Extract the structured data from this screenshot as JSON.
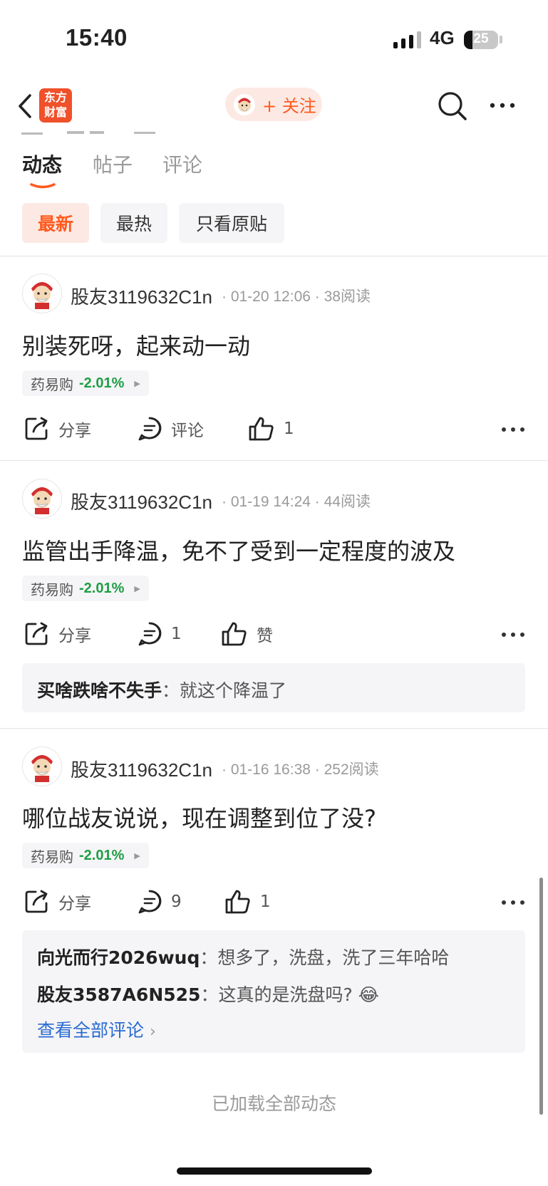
{
  "status_bar": {
    "time": "15:40",
    "network": "4G",
    "battery": "25",
    "battery_level": 0.25
  },
  "nav": {
    "logo_text": "东方财富",
    "logo_line1": "东方",
    "logo_line2": "财富",
    "follow_label": "+ 关注"
  },
  "tabs": [
    {
      "label": "动态",
      "active": true
    },
    {
      "label": "帖子",
      "active": false
    },
    {
      "label": "评论",
      "active": false
    }
  ],
  "filters": [
    {
      "label": "最新",
      "active": true
    },
    {
      "label": "最热",
      "active": false
    },
    {
      "label": "只看原贴",
      "active": false
    }
  ],
  "posts": [
    {
      "user": "股友3119632C1n",
      "date": "01-20 12:06",
      "reads": "38阅读",
      "content": "别装死呀，起来动一动",
      "stock": {
        "name": "药易购",
        "change": "-2.01%"
      },
      "actions": {
        "share": "分享",
        "comment": "评论",
        "like": "1"
      }
    },
    {
      "user": "股友3119632C1n",
      "date": "01-19 14:24",
      "reads": "44阅读",
      "content": "监管出手降温，免不了受到一定程度的波及",
      "stock": {
        "name": "药易购",
        "change": "-2.01%"
      },
      "actions": {
        "share": "分享",
        "comment": "1",
        "like": "赞"
      },
      "comments": [
        {
          "user": "买啥跌啥不失手",
          "text": "就这个降温了"
        }
      ]
    },
    {
      "user": "股友3119632C1n",
      "date": "01-16 16:38",
      "reads": "252阅读",
      "content": "哪位战友说说，现在调整到位了没?",
      "stock": {
        "name": "药易购",
        "change": "-2.01%"
      },
      "actions": {
        "share": "分享",
        "comment": "9",
        "like": "1"
      },
      "comments": [
        {
          "user": "向光而行2026wuq",
          "text": "想多了，洗盘，洗了三年哈哈"
        },
        {
          "user": "股友3587A6N525",
          "text": "这真的是洗盘吗?",
          "emoji": "😂"
        }
      ],
      "view_all": "查看全部评论"
    }
  ],
  "footer": {
    "loaded_text": "已加载全部动态"
  },
  "colors": {
    "accent": "#ff5a1f",
    "down_green": "#1f9e44",
    "link_blue": "#2a6bd1"
  }
}
